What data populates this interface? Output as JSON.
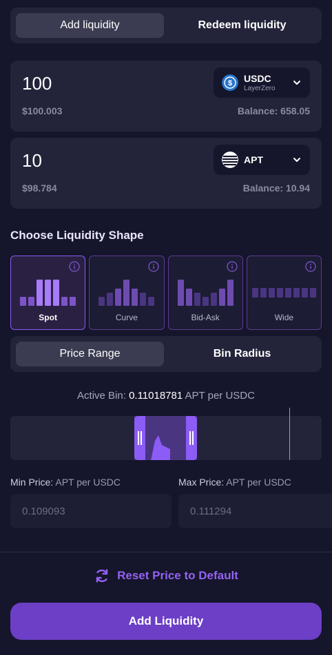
{
  "tabs": {
    "add": "Add liquidity",
    "redeem": "Redeem liquidity",
    "selected": "add"
  },
  "token_in": {
    "amount": "100",
    "usd": "$100.003",
    "balance": "Balance: 658.05",
    "symbol": "USDC",
    "chain": "LayerZero",
    "icon": "usdc-logo-icon"
  },
  "token_out": {
    "amount": "10",
    "usd": "$98.784",
    "balance": "Balance: 10.94",
    "symbol": "APT",
    "icon": "apt-logo-icon"
  },
  "shape_section": {
    "title": "Choose Liquidity Shape",
    "selected": "Spot",
    "shapes": [
      {
        "label": "Spot",
        "bars": [
          0.3,
          0.3,
          0.9,
          0.9,
          0.9,
          0.3,
          0.3
        ]
      },
      {
        "label": "Curve",
        "bars": [
          0.3,
          0.45,
          0.6,
          0.9,
          0.6,
          0.45,
          0.3
        ]
      },
      {
        "label": "Bid-Ask",
        "bars": [
          0.9,
          0.6,
          0.45,
          0.3,
          0.45,
          0.6,
          0.9
        ]
      },
      {
        "label": "Wide",
        "bars": [
          0.35,
          0.35,
          0.35,
          0.35,
          0.35,
          0.35,
          0.35,
          0.35
        ]
      }
    ]
  },
  "mode_tabs": {
    "price_range": "Price Range",
    "bin_radius": "Bin Radius",
    "selected": "price_range"
  },
  "active_bin": {
    "label": "Active Bin:",
    "value": "0.11018781",
    "unit": "APT per USDC"
  },
  "min_price": {
    "label": "Min Price:",
    "unit": "APT per USDC",
    "value": "0.109093"
  },
  "max_price": {
    "label": "Max Price:",
    "unit": "APT per USDC",
    "value": "0.111294"
  },
  "reset_label": "Reset Price to Default",
  "submit_label": "Add Liquidity",
  "colors": {
    "accent": "#8b5cf6",
    "button": "#6c3fc6",
    "panel": "#23233a",
    "background": "#15152b"
  }
}
